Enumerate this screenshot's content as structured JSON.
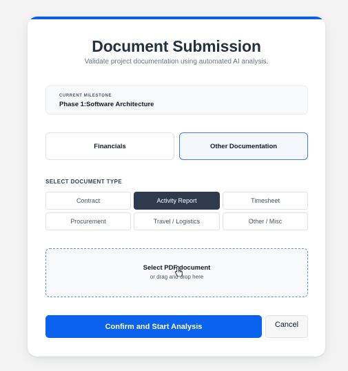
{
  "header": {
    "title": "Document Submission",
    "subtitle": "Validate project documentation using automated AI analysis."
  },
  "milestone": {
    "label": "CURRENT MILESTONE",
    "value": "Phase 1:Software Architecture"
  },
  "categories": [
    {
      "label": "Financials",
      "selected": false
    },
    {
      "label": "Other Documentation",
      "selected": true
    }
  ],
  "document_type": {
    "label": "SELECT DOCUMENT TYPE",
    "options": [
      {
        "label": "Contract",
        "selected": false
      },
      {
        "label": "Activity Report",
        "selected": true
      },
      {
        "label": "Timesheet",
        "selected": false
      },
      {
        "label": "Procurement",
        "selected": false
      },
      {
        "label": "Travel / Logistics",
        "selected": false
      },
      {
        "label": "Other / Misc",
        "selected": false
      }
    ]
  },
  "upload": {
    "title": "Select PDF document",
    "hint": "or drag and drop here",
    "cursor_icon": "hand-pointer-icon"
  },
  "actions": {
    "confirm_label": "Confirm and Start Analysis",
    "cancel_label": "Cancel"
  },
  "colors": {
    "accent": "#0a63ee",
    "selected_type_bg": "#2e3a4d",
    "selected_category_border": "#3b7ddc",
    "page_bg": "#f3f4f3"
  }
}
